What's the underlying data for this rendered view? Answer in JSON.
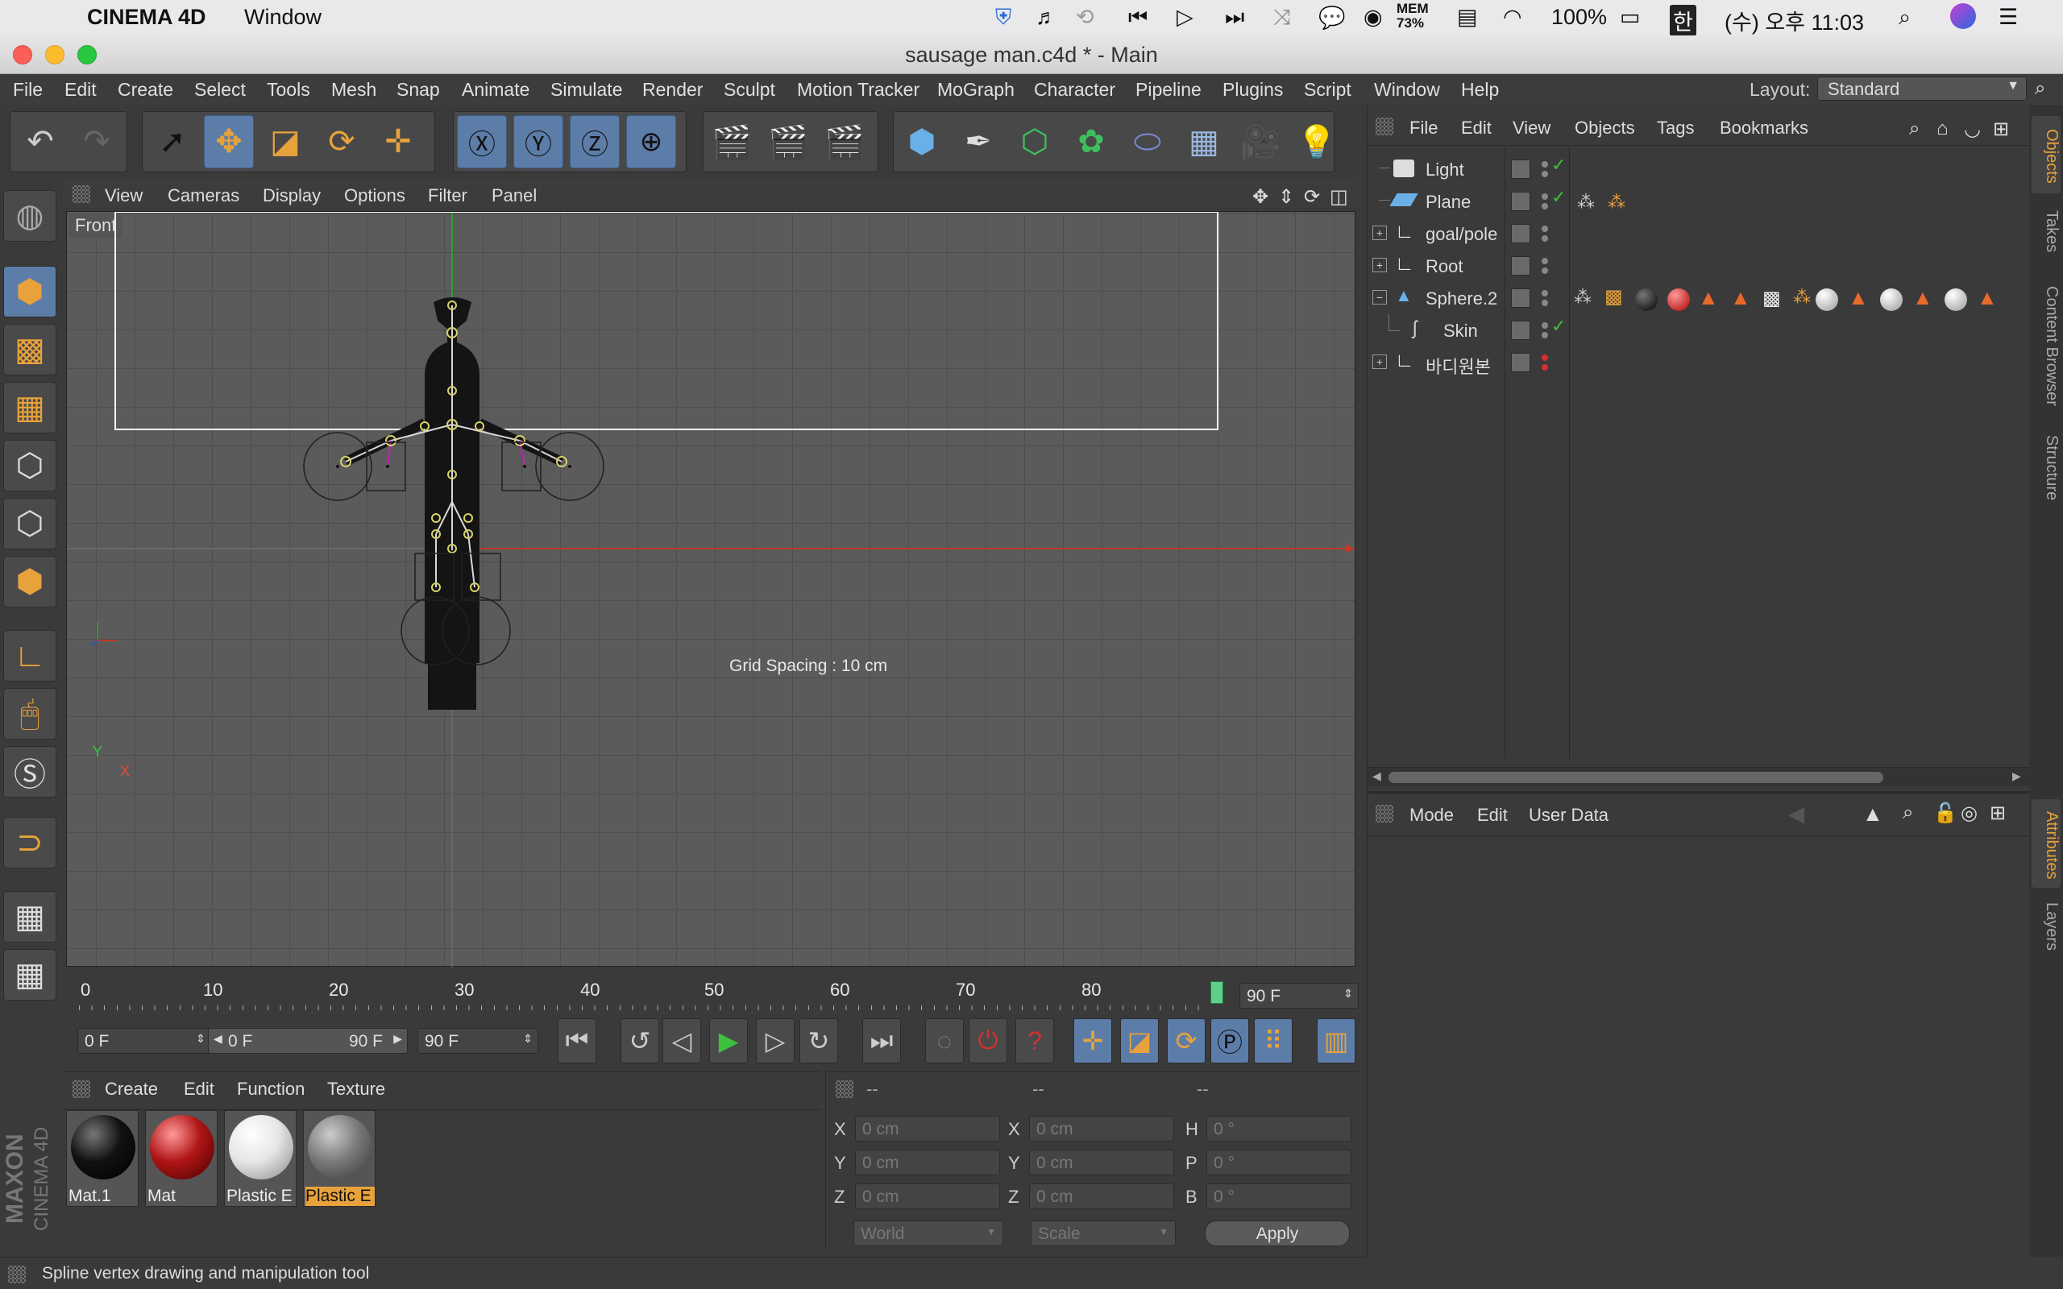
{
  "mac_menubar": {
    "app": "CINEMA 4D",
    "window": "Window",
    "mem_label": "MEM",
    "mem_value": "73%",
    "battery": "100%",
    "ime": "한",
    "clock": "(수) 오후 11:03"
  },
  "window": {
    "title": "sausage man.c4d * - Main"
  },
  "main_menu": [
    "File",
    "Edit",
    "Create",
    "Select",
    "Tools",
    "Mesh",
    "Snap",
    "Animate",
    "Simulate",
    "Render",
    "Sculpt",
    "Motion Tracker",
    "MoGraph",
    "Character",
    "Pipeline",
    "Plugins",
    "Script",
    "Window",
    "Help"
  ],
  "layout": {
    "label": "Layout:",
    "value": "Standard"
  },
  "viewport": {
    "menu": [
      "View",
      "Cameras",
      "Display",
      "Options",
      "Filter",
      "Panel"
    ],
    "camera_label": "Front",
    "grid_spacing": "Grid Spacing : 10 cm",
    "axis_y": "Y",
    "axis_x": "X"
  },
  "object_manager": {
    "menu": [
      "File",
      "Edit",
      "View",
      "Objects",
      "Tags",
      "Bookmarks"
    ],
    "objects": [
      {
        "name": "Light"
      },
      {
        "name": "Plane"
      },
      {
        "name": "goal/pole"
      },
      {
        "name": "Root"
      },
      {
        "name": "Sphere.2"
      },
      {
        "name": "Skin"
      },
      {
        "name": "바디원본"
      }
    ]
  },
  "attribute_manager": {
    "menu": [
      "Mode",
      "Edit",
      "User Data"
    ]
  },
  "side_tabs_top": [
    "Objects",
    "Takes",
    "Content Browser",
    "Structure"
  ],
  "side_tabs_bottom": [
    "Attributes",
    "Layers"
  ],
  "timeline": {
    "ticks": [
      "0",
      "10",
      "20",
      "30",
      "40",
      "50",
      "60",
      "70",
      "80"
    ],
    "end_frame": "90 F",
    "current": "0 F",
    "range_start": "0 F",
    "range_end": "90 F",
    "max_frame": "90 F"
  },
  "material_manager": {
    "menu": [
      "Create",
      "Edit",
      "Function",
      "Texture"
    ],
    "materials": [
      {
        "name": "Mat.1",
        "color": "#111111"
      },
      {
        "name": "Mat",
        "color": "#b01515"
      },
      {
        "name": "Plastic E",
        "color": "#e6e6e6"
      },
      {
        "name": "Plastic E",
        "color": "#7a7a7a"
      }
    ]
  },
  "coordinates": {
    "headers": [
      "--",
      "--",
      "--"
    ],
    "rows": [
      {
        "a": "X",
        "av": "0 cm",
        "b": "X",
        "bv": "0 cm",
        "c": "H",
        "cv": "0 °"
      },
      {
        "a": "Y",
        "av": "0 cm",
        "b": "Y",
        "bv": "0 cm",
        "c": "P",
        "cv": "0 °"
      },
      {
        "a": "Z",
        "av": "0 cm",
        "b": "Z",
        "bv": "0 cm",
        "c": "B",
        "cv": "0 °"
      }
    ],
    "space": "World",
    "mode": "Scale",
    "apply": "Apply"
  },
  "logo": {
    "brand": "MAXON",
    "product": "CINEMA 4D"
  },
  "status_bar": "Spline vertex drawing and manipulation tool",
  "accent_colors": {
    "highlight": "#5d7da9",
    "selected_tab": "#e8a23b",
    "play": "#3fbf3f"
  }
}
